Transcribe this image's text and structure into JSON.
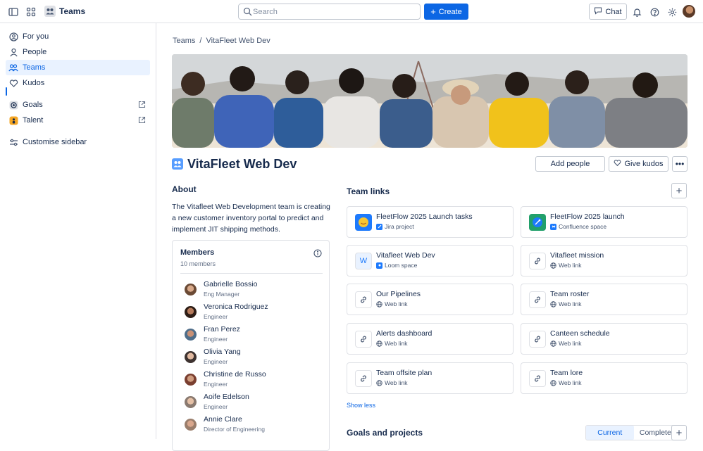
{
  "topbar": {
    "app_name": "Teams",
    "search_placeholder": "Search",
    "create_label": "Create",
    "chat_label": "Chat"
  },
  "sidebar": {
    "items": [
      {
        "label": "For you",
        "icon": "user-circle-icon"
      },
      {
        "label": "People",
        "icon": "person-icon"
      },
      {
        "label": "Teams",
        "icon": "teams-icon",
        "active": true
      },
      {
        "label": "Kudos",
        "icon": "heart-icon"
      },
      {
        "label": "Goals",
        "icon": "goal-icon"
      },
      {
        "label": "Talent",
        "icon": "talent-icon"
      },
      {
        "label": "Customise sidebar",
        "icon": "customise-icon"
      }
    ]
  },
  "breadcrumb": [
    "Teams",
    "/",
    "VitaFleet Web Dev"
  ],
  "team": {
    "title": "VitaFleet Web Dev",
    "add_people": "Add people",
    "give_kudos": "Give kudos"
  },
  "about": {
    "heading": "About",
    "text": "The Vitafleet Web Development team is creating a new customer inventory portal to predict and implement JIT shipping methods."
  },
  "members": {
    "heading": "Members",
    "count": "10 members",
    "list": [
      {
        "name": "Gabrielle Bossio",
        "role": "Eng Manager"
      },
      {
        "name": "Veronica Rodriguez",
        "role": "Engineer"
      },
      {
        "name": "Fran Perez",
        "role": "Engineer"
      },
      {
        "name": "Olivia Yang",
        "role": "Engineer"
      },
      {
        "name": "Christine de Russo",
        "role": "Engineer"
      },
      {
        "name": "Aoife Edelson",
        "role": "Engineer"
      },
      {
        "name": "Annie Clare",
        "role": "Director of Engineering"
      }
    ]
  },
  "team_links": {
    "heading": "Team links",
    "links": [
      {
        "title": "FleetFlow 2025 Launch tasks",
        "sub": "Jira project",
        "icon": "jira-project-icon"
      },
      {
        "title": "FleetFlow 2025 launch",
        "sub": "Confluence space",
        "icon": "confluence-space-icon"
      },
      {
        "title": "Vitafleet Web Dev",
        "sub": "Loom space",
        "icon": "loom-space-icon"
      },
      {
        "title": "Vitafleet mission",
        "sub": "Web link",
        "icon": "link-icon"
      },
      {
        "title": "Our Pipelines",
        "sub": "Web link",
        "icon": "link-icon"
      },
      {
        "title": "Team roster",
        "sub": "Web link",
        "icon": "link-icon"
      },
      {
        "title": "Alerts dashboard",
        "sub": "Web link",
        "icon": "link-icon"
      },
      {
        "title": "Canteen schedule",
        "sub": "Web link",
        "icon": "link-icon"
      },
      {
        "title": "Team offsite plan",
        "sub": "Web link",
        "icon": "link-icon"
      },
      {
        "title": "Team lore",
        "sub": "Web link",
        "icon": "link-icon"
      }
    ],
    "show_less": "Show less"
  },
  "goals": {
    "heading": "Goals and projects",
    "tabs": [
      "Current",
      "Completed"
    ]
  },
  "colors": {
    "accent": "#0c66e4",
    "active_bg": "#e9f2ff"
  }
}
